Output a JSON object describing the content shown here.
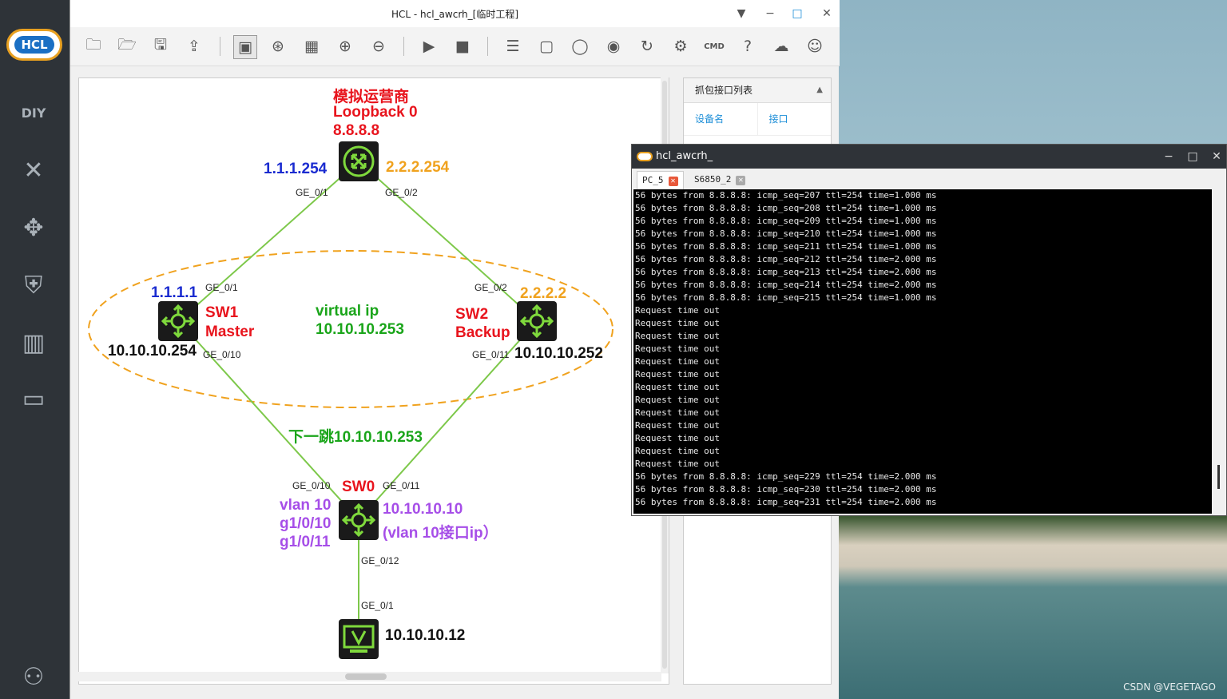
{
  "desktop": {
    "watermark": "CSDN @VEGETAGO"
  },
  "leftbar": {
    "logo_text": "HCL",
    "icons": [
      "diy-icon",
      "network-icon",
      "router-icon",
      "firewall-icon",
      "server-icon",
      "terminal-icon",
      "user-icon"
    ]
  },
  "window": {
    "title": "HCL - hcl_awcrh_[临时工程]",
    "controls": {
      "minimize": "−",
      "restore": "□",
      "close": "✕"
    }
  },
  "toolbar": {
    "icons": [
      "new-project-icon",
      "open-project-icon",
      "save-icon",
      "export-icon",
      "screenshot-icon",
      "topology-icon",
      "layout-icon",
      "zoom-in-icon",
      "zoom-out-icon",
      "start-icon",
      "stop-icon",
      "capture-list-icon",
      "add-frame-icon",
      "add-shape-icon",
      "camera-icon",
      "refresh-icon",
      "settings-icon",
      "cmd-icon",
      "help-icon",
      "wechat-icon",
      "feedback-icon"
    ]
  },
  "side_panel": {
    "title": "抓包接口列表",
    "col_device": "设备名",
    "col_interface": "接口"
  },
  "topology": {
    "isp_name": "模拟运营商",
    "isp_loopback": "Loopback 0",
    "isp_ip": "8.8.8.8",
    "isp_ge01_ip": "1.1.1.254",
    "isp_ge02_ip": "2.2.2.254",
    "port_isp_ge01": "GE_0/1",
    "port_isp_ge02": "GE_0/2",
    "sw1_uplink_ip": "1.1.1.1",
    "sw1_port_up": "GE_0/1",
    "sw1_name": "SW1",
    "sw1_role": "Master",
    "sw1_ip": "10.10.10.254",
    "sw1_port_down": "GE_0/10",
    "virtual_ip_label": "virtual ip",
    "virtual_ip": "10.10.10.253",
    "sw2_port_up": "GE_0/2",
    "sw2_uplink_ip": "2.2.2.2",
    "sw2_name": "SW2",
    "sw2_role": "Backup",
    "sw2_port_down": "GE_0/11",
    "sw2_ip": "10.10.10.252",
    "next_hop": "下一跳10.10.10.253",
    "sw0_port_left": "GE_0/10",
    "sw0_name": "SW0",
    "sw0_port_right": "GE_0/11",
    "sw0_vlan": "vlan 10",
    "sw0_if1": "g1/0/10",
    "sw0_if2": "g1/0/11",
    "sw0_ip": "10.10.10.10",
    "sw0_ip_note": "(vlan 10接口ip）",
    "sw0_port_down": "GE_0/12",
    "pc_port": "GE_0/1",
    "pc_ip": "10.10.10.12",
    "colors": {
      "link": "#7dc84a",
      "ellipse": "#f0a21e",
      "red": "#e8141d",
      "blue": "#1a2bd0",
      "orange": "#f0a21e",
      "green": "#1aa51a",
      "purple": "#a64ee8",
      "device_icon": "#7fd93c"
    }
  },
  "terminal": {
    "title": "hcl_awcrh_",
    "tabs": [
      {
        "label": "PC_5",
        "active": true
      },
      {
        "label": "S6850_2",
        "active": false
      }
    ],
    "lines": [
      "56 bytes from 8.8.8.8: icmp_seq=207 ttl=254 time=1.000 ms",
      "56 bytes from 8.8.8.8: icmp_seq=208 ttl=254 time=1.000 ms",
      "56 bytes from 8.8.8.8: icmp_seq=209 ttl=254 time=1.000 ms",
      "56 bytes from 8.8.8.8: icmp_seq=210 ttl=254 time=1.000 ms",
      "56 bytes from 8.8.8.8: icmp_seq=211 ttl=254 time=1.000 ms",
      "56 bytes from 8.8.8.8: icmp_seq=212 ttl=254 time=2.000 ms",
      "56 bytes from 8.8.8.8: icmp_seq=213 ttl=254 time=2.000 ms",
      "56 bytes from 8.8.8.8: icmp_seq=214 ttl=254 time=2.000 ms",
      "56 bytes from 8.8.8.8: icmp_seq=215 ttl=254 time=1.000 ms",
      "Request time out",
      "Request time out",
      "Request time out",
      "Request time out",
      "Request time out",
      "Request time out",
      "Request time out",
      "Request time out",
      "Request time out",
      "Request time out",
      "Request time out",
      "Request time out",
      "Request time out",
      "56 bytes from 8.8.8.8: icmp_seq=229 ttl=254 time=2.000 ms",
      "56 bytes from 8.8.8.8: icmp_seq=230 ttl=254 time=2.000 ms",
      "56 bytes from 8.8.8.8: icmp_seq=231 ttl=254 time=2.000 ms"
    ]
  }
}
